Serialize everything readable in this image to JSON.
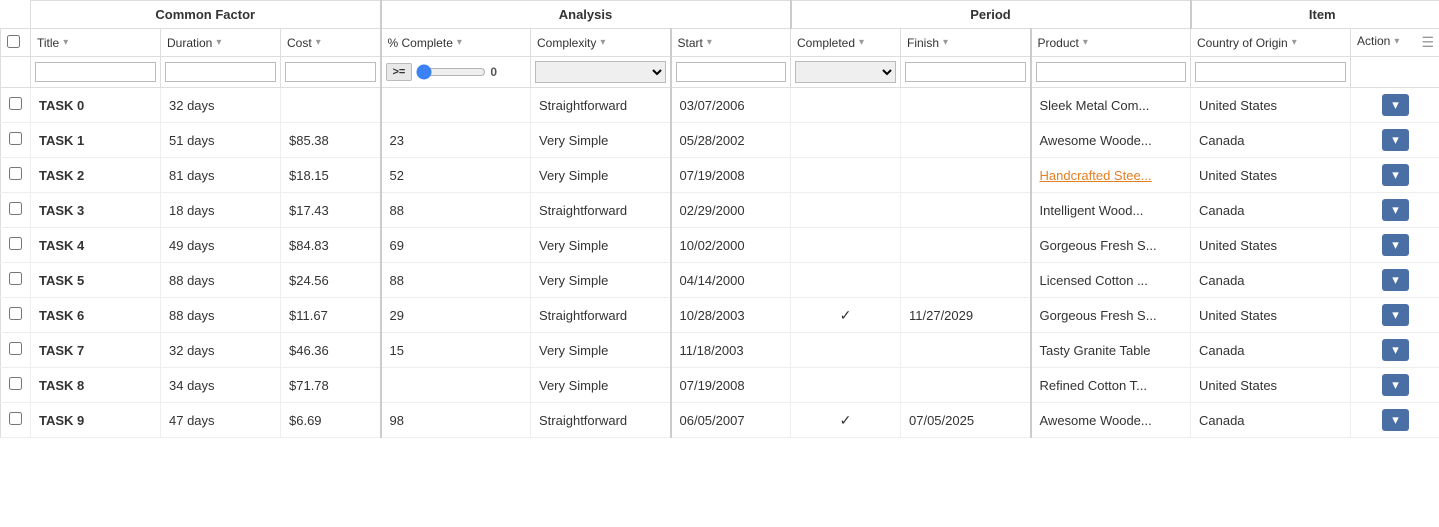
{
  "groups": [
    {
      "label": "Common Factor",
      "colspan": 3
    },
    {
      "label": "Analysis",
      "colspan": 3
    },
    {
      "label": "Period",
      "colspan": 3
    },
    {
      "label": "Item",
      "colspan": 3
    }
  ],
  "columns": [
    {
      "id": "checkbox",
      "label": "",
      "group": "common"
    },
    {
      "id": "title",
      "label": "Title",
      "group": "common"
    },
    {
      "id": "duration",
      "label": "Duration",
      "group": "common"
    },
    {
      "id": "cost",
      "label": "Cost",
      "group": "common"
    },
    {
      "id": "pct_complete",
      "label": "% Complete",
      "group": "analysis"
    },
    {
      "id": "complexity",
      "label": "Complexity",
      "group": "analysis"
    },
    {
      "id": "start",
      "label": "Start",
      "group": "period"
    },
    {
      "id": "completed",
      "label": "Completed",
      "group": "period"
    },
    {
      "id": "finish",
      "label": "Finish",
      "group": "period"
    },
    {
      "id": "product",
      "label": "Product",
      "group": "item"
    },
    {
      "id": "country",
      "label": "Country of Origin",
      "group": "item"
    },
    {
      "id": "action",
      "label": "Action",
      "group": "item"
    }
  ],
  "filters": {
    "title": "",
    "duration": "",
    "cost": "",
    "pct_complete_op": ">=",
    "pct_complete_val": 0,
    "complexity": "",
    "start": "",
    "completed": "",
    "finish": "",
    "product": "",
    "country": "",
    "action": ""
  },
  "rows": [
    {
      "id": 0,
      "title": "TASK 0",
      "duration": "32 days",
      "cost": "",
      "pct_complete": "",
      "complexity": "Straightforward",
      "start": "03/07/2006",
      "completed": "",
      "finish": "",
      "product": "Sleek Metal Com...",
      "product_link": false,
      "country": "United States",
      "action": "▾"
    },
    {
      "id": 1,
      "title": "TASK 1",
      "duration": "51 days",
      "cost": "$85.38",
      "pct_complete": "23",
      "complexity": "Very Simple",
      "start": "05/28/2002",
      "completed": "",
      "finish": "",
      "product": "Awesome Woode...",
      "product_link": false,
      "country": "Canada",
      "action": "▾"
    },
    {
      "id": 2,
      "title": "TASK 2",
      "duration": "81 days",
      "cost": "$18.15",
      "pct_complete": "52",
      "complexity": "Very Simple",
      "start": "07/19/2008",
      "completed": "",
      "finish": "",
      "product": "Handcrafted Stee...",
      "product_link": true,
      "country": "United States",
      "action": "▾"
    },
    {
      "id": 3,
      "title": "TASK 3",
      "duration": "18 days",
      "cost": "$17.43",
      "pct_complete": "88",
      "complexity": "Straightforward",
      "start": "02/29/2000",
      "completed": "",
      "finish": "",
      "product": "Intelligent Wood...",
      "product_link": false,
      "country": "Canada",
      "action": "▾"
    },
    {
      "id": 4,
      "title": "TASK 4",
      "duration": "49 days",
      "cost": "$84.83",
      "pct_complete": "69",
      "complexity": "Very Simple",
      "start": "10/02/2000",
      "completed": "",
      "finish": "",
      "product": "Gorgeous Fresh S...",
      "product_link": false,
      "country": "United States",
      "action": "▾"
    },
    {
      "id": 5,
      "title": "TASK 5",
      "duration": "88 days",
      "cost": "$24.56",
      "pct_complete": "88",
      "complexity": "Very Simple",
      "start": "04/14/2000",
      "completed": "",
      "finish": "",
      "product": "Licensed Cotton ...",
      "product_link": false,
      "country": "Canada",
      "action": "▾"
    },
    {
      "id": 6,
      "title": "TASK 6",
      "duration": "88 days",
      "cost": "$11.67",
      "pct_complete": "29",
      "complexity": "Straightforward",
      "start": "10/28/2003",
      "completed": "✓",
      "finish": "11/27/2029",
      "product": "Gorgeous Fresh S...",
      "product_link": false,
      "country": "United States",
      "action": "▾"
    },
    {
      "id": 7,
      "title": "TASK 7",
      "duration": "32 days",
      "cost": "$46.36",
      "pct_complete": "15",
      "complexity": "Very Simple",
      "start": "11/18/2003",
      "completed": "",
      "finish": "",
      "product": "Tasty Granite Table",
      "product_link": false,
      "country": "Canada",
      "action": "▾"
    },
    {
      "id": 8,
      "title": "TASK 8",
      "duration": "34 days",
      "cost": "$71.78",
      "pct_complete": "",
      "complexity": "Very Simple",
      "start": "07/19/2008",
      "completed": "",
      "finish": "",
      "product": "Refined Cotton T...",
      "product_link": false,
      "country": "United States",
      "action": "▾"
    },
    {
      "id": 9,
      "title": "TASK 9",
      "duration": "47 days",
      "cost": "$6.69",
      "pct_complete": "98",
      "complexity": "Straightforward",
      "start": "06/05/2007",
      "completed": "✓",
      "finish": "07/05/2025",
      "product": "Awesome Woode...",
      "product_link": false,
      "country": "Canada",
      "action": "▾"
    }
  ]
}
